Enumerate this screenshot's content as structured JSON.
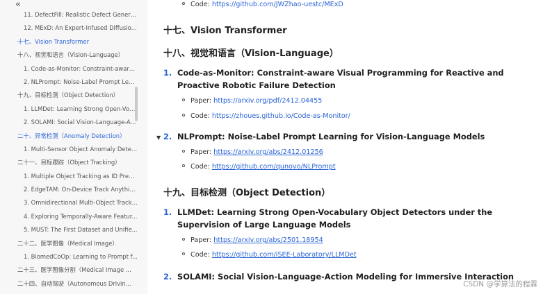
{
  "sidebar": {
    "collapse_glyph": "«",
    "items": [
      {
        "label": "11. DefectFill: Realistic Defect Genera...",
        "level": 2,
        "active": false
      },
      {
        "label": "12. MExD: An Expert-Infused Diffusio...",
        "level": 2,
        "active": false
      },
      {
        "label": "十七、Vision Transformer",
        "level": 1,
        "active": true
      },
      {
        "label": "十八、视觉和语言（Vision-Language）",
        "level": 1,
        "active": false
      },
      {
        "label": "1. Code-as-Monitor: Constraint-aware...",
        "level": 2,
        "active": false
      },
      {
        "label": "2. NLPrompt: Noise-Label Prompt Lea...",
        "level": 2,
        "active": false
      },
      {
        "label": "十九、目标检测（Object Detection）",
        "level": 1,
        "active": false
      },
      {
        "label": "1. LLMDet: Learning Strong Open-Voc...",
        "level": 2,
        "active": false
      },
      {
        "label": "2. SOLAMI: Social Vision-Language-A...",
        "level": 2,
        "active": false
      },
      {
        "label": "二十、异常检测（Anomaly Detection）",
        "level": 1,
        "active": true
      },
      {
        "label": "1. Multi-Sensor Object Anomaly Detec...",
        "level": 2,
        "active": false
      },
      {
        "label": "二十一、目标跟踪（Object Tracking）",
        "level": 1,
        "active": false
      },
      {
        "label": "1. Multiple Object Tracking as ID Pred...",
        "level": 2,
        "active": false
      },
      {
        "label": "2. EdgeTAM: On-Device Track Anythin...",
        "level": 2,
        "active": false
      },
      {
        "label": "3. Omnidirectional Multi-Object Tracki...",
        "level": 2,
        "active": false
      },
      {
        "label": "4. Exploring Temporally-Aware Featur...",
        "level": 2,
        "active": false
      },
      {
        "label": "5. MUST: The First Dataset and Unifie...",
        "level": 2,
        "active": false
      },
      {
        "label": "二十二、医学图像（Medical Image）",
        "level": 1,
        "active": false
      },
      {
        "label": "1. BiomedCoOp: Learning to Prompt f...",
        "level": 2,
        "active": false
      },
      {
        "label": "二十三、医学图像分割（Medical Image ...",
        "level": 1,
        "active": false
      },
      {
        "label": "二十四、自动驾驶（Autonomous Drivin...",
        "level": 1,
        "active": false
      }
    ]
  },
  "main": {
    "top_code_label": "Code:",
    "top_code_url": "https://github.com/JWZhao-uestc/MExD",
    "h_vit": "十七、Vision Transformer",
    "h_vl": "十八、视觉和语言（Vision-Language）",
    "vl1_num": "1.",
    "vl1_title_a": "Code-as-Monitor: Constraint-aware Visual Programming for Reactive and",
    "vl1_title_b": "Proactive Robotic Failure Detection",
    "vl1_paper_label": "Paper:",
    "vl1_paper_url": "https://arxiv.org/pdf/2412.04455",
    "vl1_code_label": "Code:",
    "vl1_code_url": "https://zhoues.github.io/Code-as-Monitor/",
    "vl2_num": "2.",
    "vl2_title": "NLPrompt: Noise-Label Prompt Learning for Vision-Language Models",
    "vl2_paper_label": "Paper:",
    "vl2_paper_url": "https://arxiv.org/abs/2412.01256",
    "vl2_code_label": "Code:",
    "vl2_code_url": "https://github.com/qunovo/NLPrompt",
    "h_od": "十九、目标检测（Object Detection）",
    "od1_num": "1.",
    "od1_title_a": "LLMDet: Learning Strong Open-Vocabulary Object Detectors under the",
    "od1_title_b": "Supervision of Large Language Models",
    "od1_paper_label": "Paper:",
    "od1_paper_url": "https://arxiv.org/abs/2501.18954",
    "od1_code_label": "Code:",
    "od1_code_url": "https://github.com/iSEE-Laboratory/LLMDet",
    "od2_num": "2.",
    "od2_title": "SOLAMI: Social Vision-Language-Action Modeling for Immersive Interaction",
    "caret_glyph": "▼"
  },
  "watermark": "CSDN @学算法的程霖",
  "colors": {
    "link": "#2a64d6",
    "sidebar_bg": "#f7f7f7",
    "active": "#2a64d6"
  }
}
